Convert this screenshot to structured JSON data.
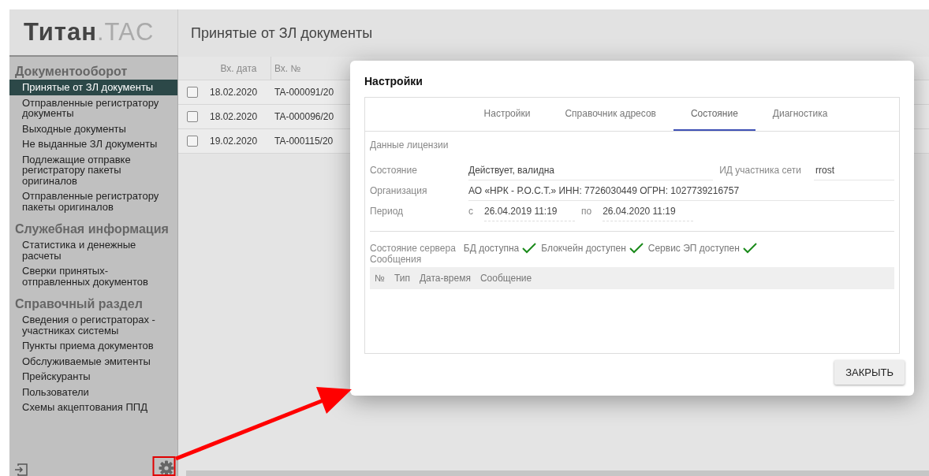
{
  "app": {
    "logo": "**Титан**.TAC",
    "page_title": "Принятые от ЗЛ документы"
  },
  "sidebar": {
    "sections": [
      {
        "title": "Документооборот",
        "items": [
          {
            "label": "Принятые от ЗЛ документы",
            "selected": true
          },
          {
            "label": "Отправленные регистратору документы",
            "selected": false
          },
          {
            "label": "Выходные документы",
            "selected": false
          },
          {
            "label": "Не выданные ЗЛ документы",
            "selected": false
          },
          {
            "label": "Подлежащие отправке регистратору пакеты оригиналов",
            "selected": false
          },
          {
            "label": "Отправленные регистратору пакеты оригиналов",
            "selected": false
          }
        ]
      },
      {
        "title": "Служебная информация",
        "items": [
          {
            "label": "Статистика и денежные расчеты",
            "selected": false
          },
          {
            "label": "Сверки принятых-отправленных документов",
            "selected": false
          }
        ]
      },
      {
        "title": "Справочный раздел",
        "items": [
          {
            "label": "Сведения о регистраторах - участниках системы",
            "selected": false
          },
          {
            "label": "Пункты приема документов",
            "selected": false
          },
          {
            "label": "Обслуживаемые эмитенты",
            "selected": false
          },
          {
            "label": "Прейскуранты",
            "selected": false
          },
          {
            "label": "Пользователи",
            "selected": false
          },
          {
            "label": "Схемы акцептования ППД",
            "selected": false
          }
        ]
      }
    ]
  },
  "table": {
    "columns": [
      "Вх. дата",
      "Вх. №"
    ],
    "rows": [
      {
        "checked": false,
        "cells": [
          "18.02.2020",
          "TA-000091/20"
        ]
      },
      {
        "checked": false,
        "cells": [
          "18.02.2020",
          "TA-000096/20"
        ]
      },
      {
        "checked": false,
        "cells": [
          "19.02.2020",
          "TA-000115/20"
        ]
      }
    ]
  },
  "dialog": {
    "title": "Настройки",
    "tabs": [
      {
        "label": "Настройки",
        "selected": false
      },
      {
        "label": "Справочник адресов",
        "selected": false
      },
      {
        "label": "Состояние",
        "selected": true
      },
      {
        "label": "Диагностика",
        "selected": false
      }
    ],
    "section_title": "Данные лицензии",
    "status": {
      "label": "Состояние",
      "value": "Действует, валидна"
    },
    "network_id": {
      "label": "ИД участника сети",
      "value": "rrost"
    },
    "organization": {
      "label": "Организация",
      "value": "АО «НРК - Р.О.С.Т.» ИНН: 7726030449 ОГРН: 1027739216757"
    },
    "period": {
      "label": "Период",
      "from_prefix": "с",
      "from": "26.04.2019 11:19",
      "to_prefix": "по",
      "to": "26.04.2020 11:19"
    },
    "server_status": {
      "label": "Состояние сервера",
      "services": [
        {
          "label": "БД доступна",
          "available": true
        },
        {
          "label": "Блокчейн доступен",
          "available": true
        },
        {
          "label": "Сервис ЭП доступен",
          "available": true
        }
      ]
    },
    "messages": {
      "label": "Сообщения",
      "columns": [
        "№",
        "Тип",
        "Дата-время",
        "Сообщение"
      ]
    },
    "close_button": "ЗАКРЫТЬ"
  }
}
